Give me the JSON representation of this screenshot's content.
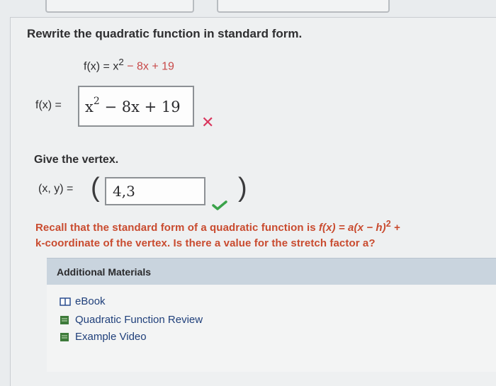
{
  "question1": {
    "prompt": "Rewrite the quadratic function in standard form.",
    "given_lhs": "f(x) = x",
    "given_exp": "2",
    "given_rhs": " − 8x + 19",
    "fx_label": "f(x) =",
    "answer_base": "x",
    "answer_exp": "2",
    "answer_rest": " − 8x + 19",
    "status": "incorrect"
  },
  "question2": {
    "prompt": "Give the vertex.",
    "xy_label": "(x, y) =",
    "open_paren": "(",
    "close_paren": ")",
    "answer": "4,3",
    "status": "correct"
  },
  "hint": {
    "line1_a": "Recall that the standard form of a quadratic function is ",
    "line1_formula": "f(x) = a(x − h)",
    "line1_exp": "2",
    "line1_tail": " +",
    "line2": "k-coordinate of the vertex. Is there a value for the stretch factor a?"
  },
  "additional_materials": {
    "title": "Additional Materials",
    "items": [
      {
        "label": "eBook",
        "icon": "book-icon"
      },
      {
        "label": "Quadratic Function Review",
        "icon": "document-icon"
      },
      {
        "label": "Example Video",
        "icon": "video-icon"
      }
    ]
  },
  "colors": {
    "error": "#d9365d",
    "success": "#3aa34a",
    "hint": "#c94b2f",
    "link": "#1f3f7a",
    "header_bg": "#c9d4de"
  }
}
